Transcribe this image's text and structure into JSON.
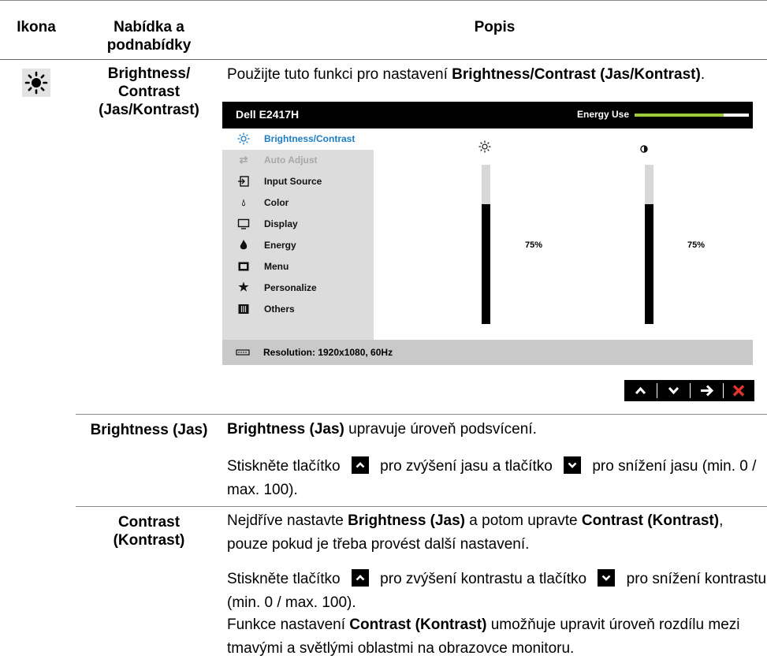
{
  "header": {
    "col_icon": "Ikona",
    "col_menu": "Nabídka a podnabídky",
    "col_desc": "Popis"
  },
  "row_main": {
    "icon": "brightness-sun-icon",
    "menu_label": "Brightness/ Contrast (Jas/Kontrast)",
    "intro_prefix": "Použijte tuto funkci pro nastavení ",
    "intro_bold": "Brightness/Contrast (Jas/Kontrast)",
    "intro_suffix": "."
  },
  "osd": {
    "model": "Dell E2417H",
    "energy_label": "Energy Use",
    "energy_level": 0.78,
    "menu_items": [
      {
        "label": "Brightness/Contrast",
        "icon": "sun-icon",
        "state": "selected"
      },
      {
        "label": "Auto Adjust",
        "icon": "auto-adjust-icon",
        "state": "disabled"
      },
      {
        "label": "Input Source",
        "icon": "input-source-icon",
        "state": "normal"
      },
      {
        "label": "Color",
        "icon": "color-icon",
        "state": "normal"
      },
      {
        "label": "Display",
        "icon": "display-icon",
        "state": "normal"
      },
      {
        "label": "Energy",
        "icon": "energy-icon",
        "state": "normal"
      },
      {
        "label": "Menu",
        "icon": "menu-icon",
        "state": "normal"
      },
      {
        "label": "Personalize",
        "icon": "star-icon",
        "state": "normal"
      },
      {
        "label": "Others",
        "icon": "others-icon",
        "state": "normal"
      }
    ],
    "brightness": {
      "icon": "sun-icon",
      "value_text": "75%",
      "value": 75
    },
    "contrast": {
      "icon": "contrast-icon",
      "value_text": "75%",
      "value": 75
    },
    "resolution": "Resolution: 1920x1080, 60Hz",
    "nav_buttons": [
      "up-arrow-icon",
      "down-arrow-icon",
      "right-arrow-icon",
      "close-icon"
    ],
    "colors": {
      "accent_blue": "#1a7dc4",
      "energy_green": "#9ccc3c",
      "close_red": "#e0352b"
    }
  },
  "row_brightness": {
    "menu_label": "Brightness (Jas)",
    "p1_bold": "Brightness (Jas)",
    "p1_rest": " upravuje úroveň podsvícení.",
    "p2_a": "Stiskněte tlačítko ",
    "p2_b": " pro zvýšení jasu a tlačítko ",
    "p2_c": " pro snížení jasu (min. 0 / max. 100)."
  },
  "row_contrast": {
    "menu_label": "Contrast (Kontrast)",
    "p1_a": "Nejdříve nastavte ",
    "p1_b": "Brightness (Jas)",
    "p1_c": " a potom upravte ",
    "p1_d": "Contrast (Kontrast)",
    "p1_e": ", pouze pokud je třeba provést další nastavení.",
    "p2_a": "Stiskněte tlačítko ",
    "p2_b": " pro zvýšení kontrastu a tlačítko ",
    "p2_c": " pro snížení kontrastu (min. 0 / max. 100).",
    "p3_a": "Funkce nastavení ",
    "p3_b": "Contrast (Kontrast)",
    "p3_c": " umožňuje upravit úroveň rozdílu mezi tmavými a světlými oblastmi na obrazovce monitoru."
  }
}
